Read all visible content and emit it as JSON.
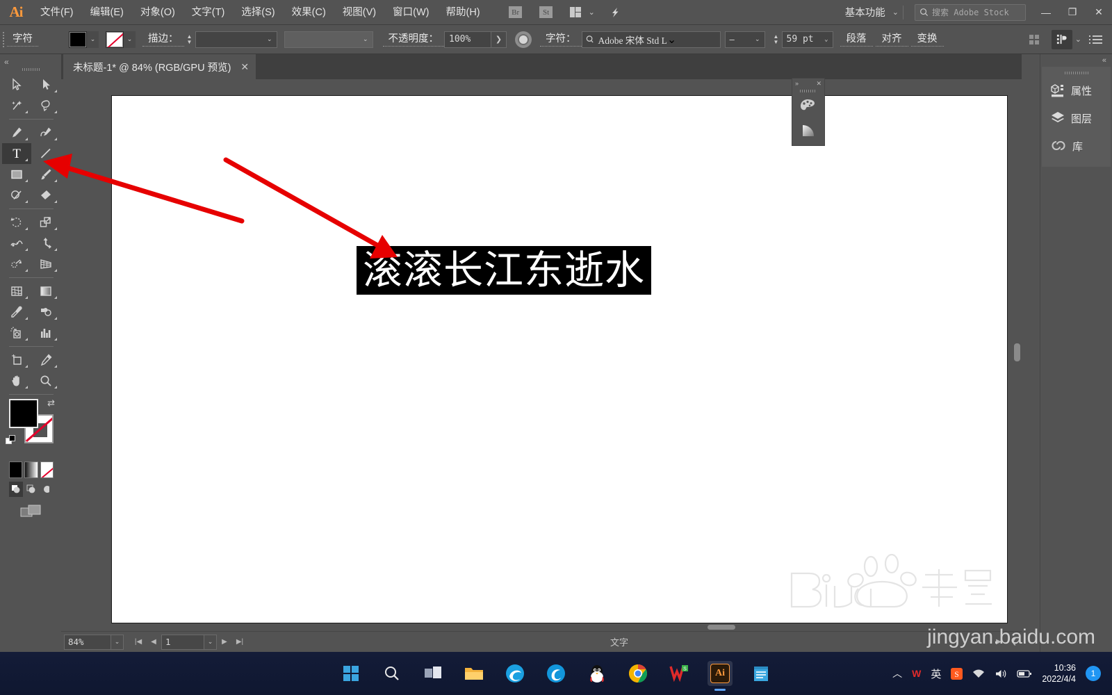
{
  "app": {
    "logo": "Ai"
  },
  "menubar": {
    "items": [
      "文件(F)",
      "编辑(E)",
      "对象(O)",
      "文字(T)",
      "选择(S)",
      "效果(C)",
      "视图(V)",
      "窗口(W)",
      "帮助(H)"
    ],
    "bridge_label": "Br",
    "stock_label": "St",
    "workspace": "基本功能",
    "search_placeholder": "搜索 Adobe Stock",
    "minimize": "—",
    "restore": "❐",
    "close": "✕"
  },
  "control_bar": {
    "character_label": "字符",
    "fill_color": "#000000",
    "stroke_label": "描边：",
    "stroke_weight": "",
    "stroke_profile": "",
    "opacity_label": "不透明度：",
    "opacity_value": "100%",
    "font_label": "字符：",
    "font_name": "Adobe 宋体 Std L",
    "font_style": "–",
    "font_size": "59 pt",
    "paragraph_button": "段落",
    "align_button": "对齐",
    "transform_button": "变换"
  },
  "tab": {
    "title": "未标题-1* @ 84% (RGB/GPU 预览)",
    "close": "✕"
  },
  "toolbar": {
    "tools": [
      {
        "name": "selection-tool",
        "glyph": "selection"
      },
      {
        "name": "direct-selection-tool",
        "glyph": "direct-selection"
      },
      {
        "name": "magic-wand-tool",
        "glyph": "magic-wand"
      },
      {
        "name": "lasso-tool",
        "glyph": "lasso"
      },
      {
        "name": "pen-tool",
        "glyph": "pen"
      },
      {
        "name": "curvature-tool",
        "glyph": "curvature"
      },
      {
        "name": "type-tool",
        "glyph": "type",
        "selected": true
      },
      {
        "name": "line-segment-tool",
        "glyph": "line"
      },
      {
        "name": "rectangle-tool",
        "glyph": "rectangle"
      },
      {
        "name": "paintbrush-tool",
        "glyph": "paintbrush"
      },
      {
        "name": "shaper-tool",
        "glyph": "shaper"
      },
      {
        "name": "eraser-tool",
        "glyph": "eraser"
      },
      {
        "name": "rotate-tool",
        "glyph": "rotate"
      },
      {
        "name": "scale-tool",
        "glyph": "scale"
      },
      {
        "name": "width-tool",
        "glyph": "width"
      },
      {
        "name": "free-transform-tool",
        "glyph": "free-transform"
      },
      {
        "name": "shape-builder-tool",
        "glyph": "shape-builder"
      },
      {
        "name": "perspective-grid-tool",
        "glyph": "perspective-grid"
      },
      {
        "name": "mesh-tool",
        "glyph": "mesh"
      },
      {
        "name": "gradient-tool",
        "glyph": "gradient"
      },
      {
        "name": "eyedropper-tool",
        "glyph": "eyedropper"
      },
      {
        "name": "blend-tool",
        "glyph": "blend"
      },
      {
        "name": "symbol-sprayer-tool",
        "glyph": "symbol-sprayer"
      },
      {
        "name": "column-graph-tool",
        "glyph": "column-graph"
      },
      {
        "name": "artboard-tool",
        "glyph": "artboard"
      },
      {
        "name": "slice-tool",
        "glyph": "slice"
      },
      {
        "name": "hand-tool",
        "glyph": "hand"
      },
      {
        "name": "zoom-tool",
        "glyph": "zoom"
      }
    ],
    "fill_color": "#000000",
    "stroke_color": "none",
    "mode_color": "color",
    "mode_gradient": "gradient",
    "mode_none": "none"
  },
  "canvas": {
    "artboard_text": "滚滚长江东逝水",
    "text_selected": true
  },
  "float_panel": {
    "collapse": "»",
    "close": "✕",
    "items": [
      "swatches-icon",
      "gradient-icon"
    ]
  },
  "right_dock": {
    "collapse": "«",
    "items": [
      {
        "label": "属性",
        "icon": "properties-icon"
      },
      {
        "label": "图层",
        "icon": "layers-icon"
      },
      {
        "label": "库",
        "icon": "libraries-icon"
      }
    ]
  },
  "status_bar": {
    "zoom": "84%",
    "page": "1",
    "tool_status": "文字"
  },
  "taskbar": {
    "apps": [
      {
        "name": "start-button",
        "label": "start"
      },
      {
        "name": "search-button",
        "label": "search"
      },
      {
        "name": "task-view-button",
        "label": "task-view"
      },
      {
        "name": "file-explorer",
        "label": "explorer"
      },
      {
        "name": "edge-browser",
        "label": "edge"
      },
      {
        "name": "qq-browser",
        "label": "qq-browser"
      },
      {
        "name": "qq-messenger",
        "label": "qq"
      },
      {
        "name": "chrome-browser",
        "label": "chrome"
      },
      {
        "name": "wps-office",
        "label": "wps"
      },
      {
        "name": "illustrator-app",
        "label": "Ai",
        "active": true
      },
      {
        "name": "notepad-app",
        "label": "notepad"
      }
    ],
    "tray": {
      "overflow": "︿",
      "wps": "W",
      "ime": "英",
      "sogou": "S",
      "wifi": "wifi",
      "volume": "volume",
      "battery": "battery"
    },
    "time": "10:36",
    "date": "2022/4/4",
    "notification_count": "1"
  },
  "watermark": {
    "logo": "Baidu经验",
    "url": "jingyan.baidu.com"
  }
}
